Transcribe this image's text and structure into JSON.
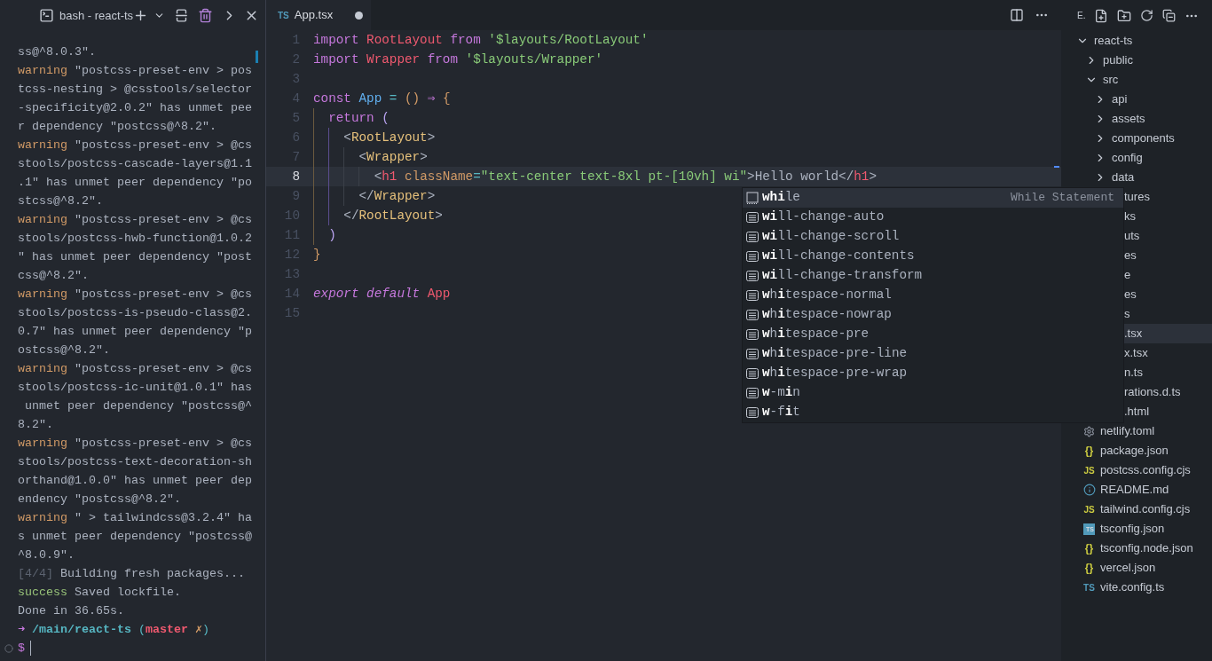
{
  "terminal": {
    "title": "bash - react-ts",
    "lines": [
      [
        {
          "text": "ss@^8.0.3\".",
          "kind": "plain"
        }
      ],
      [
        {
          "text": "warning",
          "kind": "warning"
        },
        {
          "text": " \"postcss-preset-env > pos",
          "kind": "plain"
        }
      ],
      [
        {
          "text": "tcss-nesting > @csstools/selector",
          "kind": "plain"
        }
      ],
      [
        {
          "text": "-specificity@2.0.2\" has unmet pee",
          "kind": "plain"
        }
      ],
      [
        {
          "text": "r dependency \"postcss@^8.2\".",
          "kind": "plain"
        }
      ],
      [
        {
          "text": "warning",
          "kind": "warning"
        },
        {
          "text": " \"postcss-preset-env > @cs",
          "kind": "plain"
        }
      ],
      [
        {
          "text": "stools/postcss-cascade-layers@1.1",
          "kind": "plain"
        }
      ],
      [
        {
          "text": ".1\" has unmet peer dependency \"po",
          "kind": "plain"
        }
      ],
      [
        {
          "text": "stcss@^8.2\".",
          "kind": "plain"
        }
      ],
      [
        {
          "text": "warning",
          "kind": "warning"
        },
        {
          "text": " \"postcss-preset-env > @cs",
          "kind": "plain"
        }
      ],
      [
        {
          "text": "stools/postcss-hwb-function@1.0.2",
          "kind": "plain"
        }
      ],
      [
        {
          "text": "\" has unmet peer dependency \"post",
          "kind": "plain"
        }
      ],
      [
        {
          "text": "css@^8.2\".",
          "kind": "plain"
        }
      ],
      [
        {
          "text": "warning",
          "kind": "warning"
        },
        {
          "text": " \"postcss-preset-env > @cs",
          "kind": "plain"
        }
      ],
      [
        {
          "text": "stools/postcss-is-pseudo-class@2.",
          "kind": "plain"
        }
      ],
      [
        {
          "text": "0.7\" has unmet peer dependency \"p",
          "kind": "plain"
        }
      ],
      [
        {
          "text": "ostcss@^8.2\".",
          "kind": "plain"
        }
      ],
      [
        {
          "text": "warning",
          "kind": "warning"
        },
        {
          "text": " \"postcss-preset-env > @cs",
          "kind": "plain"
        }
      ],
      [
        {
          "text": "stools/postcss-ic-unit@1.0.1\" has",
          "kind": "plain"
        }
      ],
      [
        {
          "text": " unmet peer dependency \"postcss@^",
          "kind": "plain"
        }
      ],
      [
        {
          "text": "8.2\".",
          "kind": "plain"
        }
      ],
      [
        {
          "text": "warning",
          "kind": "warning"
        },
        {
          "text": " \"postcss-preset-env > @cs",
          "kind": "plain"
        }
      ],
      [
        {
          "text": "stools/postcss-text-decoration-sh",
          "kind": "plain"
        }
      ],
      [
        {
          "text": "orthand@1.0.0\" has unmet peer dep",
          "kind": "plain"
        }
      ],
      [
        {
          "text": "endency \"postcss@^8.2\".",
          "kind": "plain"
        }
      ],
      [
        {
          "text": "warning",
          "kind": "warning"
        },
        {
          "text": " \" > tailwindcss@3.2.4\" ha",
          "kind": "plain"
        }
      ],
      [
        {
          "text": "s unmet peer dependency \"postcss@",
          "kind": "plain"
        }
      ],
      [
        {
          "text": "^8.0.9\".",
          "kind": "plain"
        }
      ],
      [
        {
          "text": "[4/4]",
          "kind": "dim"
        },
        {
          "text": " Building fresh packages...",
          "kind": "plain"
        }
      ],
      [
        {
          "text": "success",
          "kind": "success"
        },
        {
          "text": " Saved lockfile.",
          "kind": "plain"
        }
      ],
      [
        {
          "text": "Done in 36.65s.",
          "kind": "plain"
        }
      ],
      [
        {
          "text": "➜",
          "kind": "arrow"
        },
        {
          "text": " /main/react-ts",
          "kind": "path"
        },
        {
          "text": " (",
          "kind": "paren"
        },
        {
          "text": "master",
          "kind": "branch"
        },
        {
          "text": " ✗",
          "kind": "dirty"
        },
        {
          "text": ")",
          "kind": "paren"
        }
      ]
    ],
    "prompt": "$"
  },
  "editor": {
    "tab": {
      "badge": "TS",
      "label": "App.tsx",
      "modified": true,
      "selected": true
    },
    "lines": [
      {
        "number": "1",
        "current": false,
        "tokens": [
          {
            "text": "import",
            "kind": "keyword"
          },
          {
            "text": " RootLayout",
            "kind": "component"
          },
          {
            "text": " from",
            "kind": "keyword"
          },
          {
            "text": " '$layouts/RootLayout'",
            "kind": "string"
          }
        ]
      },
      {
        "number": "2",
        "current": false,
        "tokens": [
          {
            "text": "import",
            "kind": "keyword"
          },
          {
            "text": " Wrapper",
            "kind": "component"
          },
          {
            "text": " from",
            "kind": "keyword"
          },
          {
            "text": " '$layouts/Wrapper'",
            "kind": "string"
          }
        ]
      },
      {
        "number": "3",
        "current": false
      },
      {
        "number": "4",
        "current": false,
        "tokens": [
          {
            "text": "const",
            "kind": "keyword"
          },
          {
            "text": " App",
            "kind": "function"
          },
          {
            "text": " =",
            "kind": "operator"
          },
          {
            "text": " ()",
            "kind": "bracket"
          },
          {
            "text": " ⇒",
            "kind": "keyword"
          },
          {
            "text": " {",
            "kind": "bracket"
          }
        ]
      },
      {
        "number": "5",
        "current": false,
        "tokens": [
          {
            "text": "  return",
            "kind": "keyword"
          },
          {
            "text": " (",
            "kind": "matched"
          }
        ]
      },
      {
        "number": "6",
        "current": false,
        "tokens": [
          {
            "text": "    <",
            "kind": "punctuation"
          },
          {
            "text": "RootLayout",
            "kind": "tag"
          },
          {
            "text": ">",
            "kind": "punctuation"
          }
        ]
      },
      {
        "number": "7",
        "current": false,
        "tokens": [
          {
            "text": "      <",
            "kind": "punctuation"
          },
          {
            "text": "Wrapper",
            "kind": "tag"
          },
          {
            "text": ">",
            "kind": "punctuation"
          }
        ]
      },
      {
        "number": "8",
        "current": true,
        "tokens": [
          {
            "text": "        <",
            "kind": "punctuation"
          },
          {
            "text": "h1",
            "kind": "element"
          },
          {
            "text": " className",
            "kind": "attribute"
          },
          {
            "text": "=",
            "kind": "operator"
          },
          {
            "text": "\"text-center text-8xl pt-[10vh] wi\"",
            "kind": "string"
          },
          {
            "text": ">",
            "kind": "punctuation"
          },
          {
            "text": "Hello world",
            "kind": "plain"
          },
          {
            "text": "</",
            "kind": "punctuation"
          },
          {
            "text": "h1",
            "kind": "element"
          },
          {
            "text": ">",
            "kind": "punctuation"
          }
        ]
      },
      {
        "number": "9",
        "current": false,
        "tokens": [
          {
            "text": "      </",
            "kind": "punctuation"
          },
          {
            "text": "Wrapper",
            "kind": "tag"
          },
          {
            "text": ">",
            "kind": "punctuation"
          }
        ]
      },
      {
        "number": "10",
        "current": false,
        "tokens": [
          {
            "text": "    </",
            "kind": "punctuation"
          },
          {
            "text": "RootLayout",
            "kind": "tag"
          },
          {
            "text": ">",
            "kind": "punctuation"
          }
        ]
      },
      {
        "number": "11",
        "current": false,
        "tokens": [
          {
            "text": "  )",
            "kind": "matched"
          }
        ]
      },
      {
        "number": "12",
        "current": false,
        "tokens": [
          {
            "text": "}",
            "kind": "bracket"
          }
        ]
      },
      {
        "number": "13",
        "current": false
      },
      {
        "number": "14",
        "current": false,
        "tokens": [
          {
            "text": "export",
            "kind": "italic"
          },
          {
            "text": " default",
            "kind": "italic"
          },
          {
            "text": " App",
            "kind": "component"
          }
        ]
      },
      {
        "number": "15",
        "current": false
      }
    ]
  },
  "suggestions": [
    {
      "label": "**whi**le",
      "kind": "snippet",
      "selected": true,
      "detail": "While Statement"
    },
    {
      "label": "**wi**ll-change-auto",
      "kind": "value",
      "selected": false
    },
    {
      "label": "**wi**ll-change-scroll",
      "kind": "value",
      "selected": false
    },
    {
      "label": "**wi**ll-change-contents",
      "kind": "value",
      "selected": false
    },
    {
      "label": "**wi**ll-change-transform",
      "kind": "value",
      "selected": false
    },
    {
      "label": "**w**h**i**tespace-normal",
      "kind": "value",
      "selected": false
    },
    {
      "label": "**w**h**i**tespace-nowrap",
      "kind": "value",
      "selected": false
    },
    {
      "label": "**w**h**i**tespace-pre",
      "kind": "value",
      "selected": false
    },
    {
      "label": "**w**h**i**tespace-pre-line",
      "kind": "value",
      "selected": false
    },
    {
      "label": "**w**h**i**tespace-pre-wrap",
      "kind": "value",
      "selected": false
    },
    {
      "label": "**w**-m**i**n",
      "kind": "value",
      "selected": false
    },
    {
      "label": "**w**-f**i**t",
      "kind": "value",
      "selected": false
    }
  ],
  "explorer": {
    "title": "E.",
    "tree": [
      {
        "name": "react-ts",
        "kind": "folder",
        "expanded": true,
        "selected": false,
        "children": [
          {
            "name": "public",
            "kind": "folder",
            "expanded": false,
            "selected": false
          },
          {
            "name": "src",
            "kind": "folder",
            "expanded": true,
            "selected": false,
            "children": [
              {
                "name": "api",
                "kind": "folder",
                "expanded": false,
                "selected": false
              },
              {
                "name": "assets",
                "kind": "folder",
                "expanded": false,
                "selected": false
              },
              {
                "name": "components",
                "kind": "folder",
                "expanded": false,
                "selected": false
              },
              {
                "name": "config",
                "kind": "folder",
                "expanded": false,
                "selected": false
              },
              {
                "name": "data",
                "kind": "folder",
                "expanded": false,
                "selected": false
              },
              {
                "name": "tures",
                "kind": "fragment",
                "selected": false
              },
              {
                "name": "ks",
                "kind": "fragment",
                "selected": false
              },
              {
                "name": "uts",
                "kind": "fragment",
                "selected": false
              },
              {
                "name": "es",
                "kind": "fragment",
                "selected": false
              },
              {
                "name": "e",
                "kind": "fragment",
                "selected": false
              },
              {
                "name": "es",
                "kind": "fragment",
                "selected": false
              },
              {
                "name": "s",
                "kind": "fragment",
                "selected": false
              },
              {
                "name": ".tsx",
                "kind": "fragment",
                "selected": true
              },
              {
                "name": "x.tsx",
                "kind": "fragment",
                "selected": false
              },
              {
                "name": "n.ts",
                "kind": "fragment",
                "selected": false
              },
              {
                "name": "rations.d.ts",
                "kind": "fragment",
                "selected": false
              },
              {
                "name": ".html",
                "kind": "fragment",
                "selected": false
              }
            ]
          },
          {
            "name": "netlify.toml",
            "kind": "gear",
            "selected": false
          },
          {
            "name": "package.json",
            "kind": "braces",
            "badge": "{}",
            "selected": false
          },
          {
            "name": "postcss.config.cjs",
            "kind": "js",
            "badge": "JS",
            "selected": false
          },
          {
            "name": "README.md",
            "kind": "info",
            "selected": false
          },
          {
            "name": "tailwind.config.cjs",
            "kind": "js",
            "badge": "JS",
            "selected": false
          },
          {
            "name": "tsconfig.json",
            "kind": "tsbox",
            "badge": "TS",
            "selected": false
          },
          {
            "name": "tsconfig.node.json",
            "kind": "braces",
            "badge": "{}",
            "selected": false
          },
          {
            "name": "vercel.json",
            "kind": "braces",
            "badge": "{}",
            "selected": false
          },
          {
            "name": "vite.config.ts",
            "kind": "ts",
            "badge": "TS",
            "selected": false
          }
        ]
      }
    ]
  }
}
